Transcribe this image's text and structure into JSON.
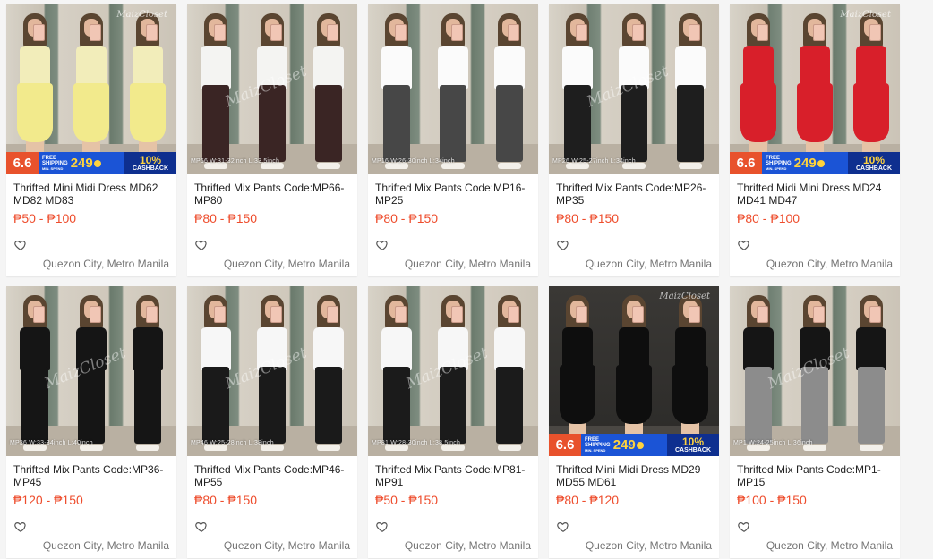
{
  "products": [
    {
      "title": "Thrifted Mini Midi Dress MD62 MD82 MD83",
      "price": "₱50 - ₱100",
      "location": "Quezon City, Metro Manila",
      "style": "dress",
      "bg": "light",
      "outfit": [
        {
          "top": "#f2edba",
          "bottom": "#f2ea8c"
        },
        {
          "top": "#f2edba",
          "bottom": "#f2ea8c"
        },
        {
          "top": "#f2edba",
          "bottom": "#f2ea8c"
        }
      ],
      "promo": true,
      "size_tag": "",
      "watermark": "",
      "brand_mark": "MaizCloset"
    },
    {
      "title": "Thrifted Mix Pants Code:MP66-MP80",
      "price": "₱80 - ₱150",
      "location": "Quezon City, Metro Manila",
      "style": "pants",
      "bg": "light",
      "outfit": [
        {
          "top": "#f4f4f2",
          "bottom": "#3a2524"
        },
        {
          "top": "#f4f4f2",
          "bottom": "#3a2524"
        },
        {
          "top": "#f4f4f2",
          "bottom": "#3a2524"
        }
      ],
      "promo": false,
      "size_tag": "MP66 W:31-32inch L:33.5inch",
      "watermark": "MaizCloset",
      "brand_mark": ""
    },
    {
      "title": "Thrifted Mix Pants Code:MP16-MP25",
      "price": "₱80 - ₱150",
      "location": "Quezon City, Metro Manila",
      "style": "pants",
      "bg": "light",
      "outfit": [
        {
          "top": "#fbfbfb",
          "bottom": "#474747"
        },
        {
          "top": "#fbfbfb",
          "bottom": "#474747"
        },
        {
          "top": "#fbfbfb",
          "bottom": "#474747"
        }
      ],
      "promo": false,
      "size_tag": "MP16 W:26-30inch L:34inch",
      "watermark": "",
      "brand_mark": ""
    },
    {
      "title": "Thrifted Mix Pants Code:MP26-MP35",
      "price": "₱80 - ₱150",
      "location": "Quezon City, Metro Manila",
      "style": "pants",
      "bg": "light",
      "outfit": [
        {
          "top": "#fbfbfb",
          "bottom": "#1e1e1e"
        },
        {
          "top": "#fbfbfb",
          "bottom": "#1e1e1e"
        },
        {
          "top": "#fbfbfb",
          "bottom": "#1e1e1e"
        }
      ],
      "promo": false,
      "size_tag": "MP26 W:25-27inch L:34inch",
      "watermark": "MaizCloset",
      "brand_mark": ""
    },
    {
      "title": "Thrifted Midi Mini Dress MD24 MD41 MD47",
      "price": "₱80 - ₱100",
      "location": "Quezon City, Metro Manila",
      "style": "dress",
      "bg": "light",
      "outfit": [
        {
          "top": "#d81f2a",
          "bottom": "#d81f2a"
        },
        {
          "top": "#d81f2a",
          "bottom": "#d81f2a"
        },
        {
          "top": "#d81f2a",
          "bottom": "#d81f2a"
        }
      ],
      "promo": true,
      "size_tag": "",
      "watermark": "",
      "brand_mark": "MaizCloset"
    },
    {
      "title": "Thrifted Mix Pants Code:MP36-MP45",
      "price": "₱120 - ₱150",
      "location": "Quezon City, Metro Manila",
      "style": "pants",
      "bg": "light",
      "outfit": [
        {
          "top": "#151515",
          "bottom": "#151515"
        },
        {
          "top": "#151515",
          "bottom": "#151515"
        },
        {
          "top": "#151515",
          "bottom": "#151515"
        }
      ],
      "promo": false,
      "size_tag": "MP36 W:33-34inch L:40inch",
      "watermark": "MaizCloset",
      "brand_mark": ""
    },
    {
      "title": "Thrifted Mix Pants Code:MP46-MP55",
      "price": "₱80 - ₱150",
      "location": "Quezon City, Metro Manila",
      "style": "pants",
      "bg": "light",
      "outfit": [
        {
          "top": "#f7f7f7",
          "bottom": "#1a1a1a"
        },
        {
          "top": "#f7f7f7",
          "bottom": "#1a1a1a"
        },
        {
          "top": "#f7f7f7",
          "bottom": "#1a1a1a"
        }
      ],
      "promo": false,
      "size_tag": "MP46 W:25-28inch L:38inch",
      "watermark": "MaizCloset",
      "brand_mark": ""
    },
    {
      "title": "Thrifted Mix Pants Code:MP81-MP91",
      "price": "₱50 - ₱150",
      "location": "Quezon City, Metro Manila",
      "style": "pants",
      "bg": "light",
      "outfit": [
        {
          "top": "#f7f7f7",
          "bottom": "#1b1b1b"
        },
        {
          "top": "#f7f7f7",
          "bottom": "#1b1b1b"
        },
        {
          "top": "#f7f7f7",
          "bottom": "#1b1b1b"
        }
      ],
      "promo": false,
      "size_tag": "MP81 W:28-30inch L:38.5inch",
      "watermark": "MaizCloset",
      "brand_mark": ""
    },
    {
      "title": "Thrifted Mini Midi Dress MD29 MD55 MD61",
      "price": "₱80 - ₱120",
      "location": "Quezon City, Metro Manila",
      "style": "dress",
      "bg": "dark",
      "outfit": [
        {
          "top": "#0e0e0e",
          "bottom": "#0e0e0e"
        },
        {
          "top": "#0e0e0e",
          "bottom": "#0e0e0e"
        },
        {
          "top": "#0e0e0e",
          "bottom": "#0e0e0e"
        }
      ],
      "promo": true,
      "size_tag": "",
      "watermark": "",
      "brand_mark": "MaizCloset"
    },
    {
      "title": "Thrifted Mix Pants Code:MP1-MP15",
      "price": "₱100 - ₱150",
      "location": "Quezon City, Metro Manila",
      "style": "pants",
      "bg": "light",
      "outfit": [
        {
          "top": "#151515",
          "bottom": "#8c8c8c"
        },
        {
          "top": "#151515",
          "bottom": "#8c8c8c"
        },
        {
          "top": "#151515",
          "bottom": "#8c8c8c"
        }
      ],
      "promo": false,
      "size_tag": "MP1 W:24-25inch L:36inch",
      "watermark": "MaizCloset",
      "brand_mark": ""
    }
  ],
  "promo": {
    "number": "6.6",
    "free_line": "FREE",
    "shipping_line": "SHIPPING",
    "min_line": "MIN. SPEND",
    "amount": "249",
    "cashback_pct": "10%",
    "cashback_label": "CASHBACK"
  },
  "icons": {
    "wishlist": "heart-outline-icon"
  },
  "colors": {
    "price": "#ee4d2d",
    "location": "#757575",
    "promo_orange": "#e8522c",
    "promo_blue": "#1b54d6",
    "promo_yellow": "#ffd33d"
  }
}
